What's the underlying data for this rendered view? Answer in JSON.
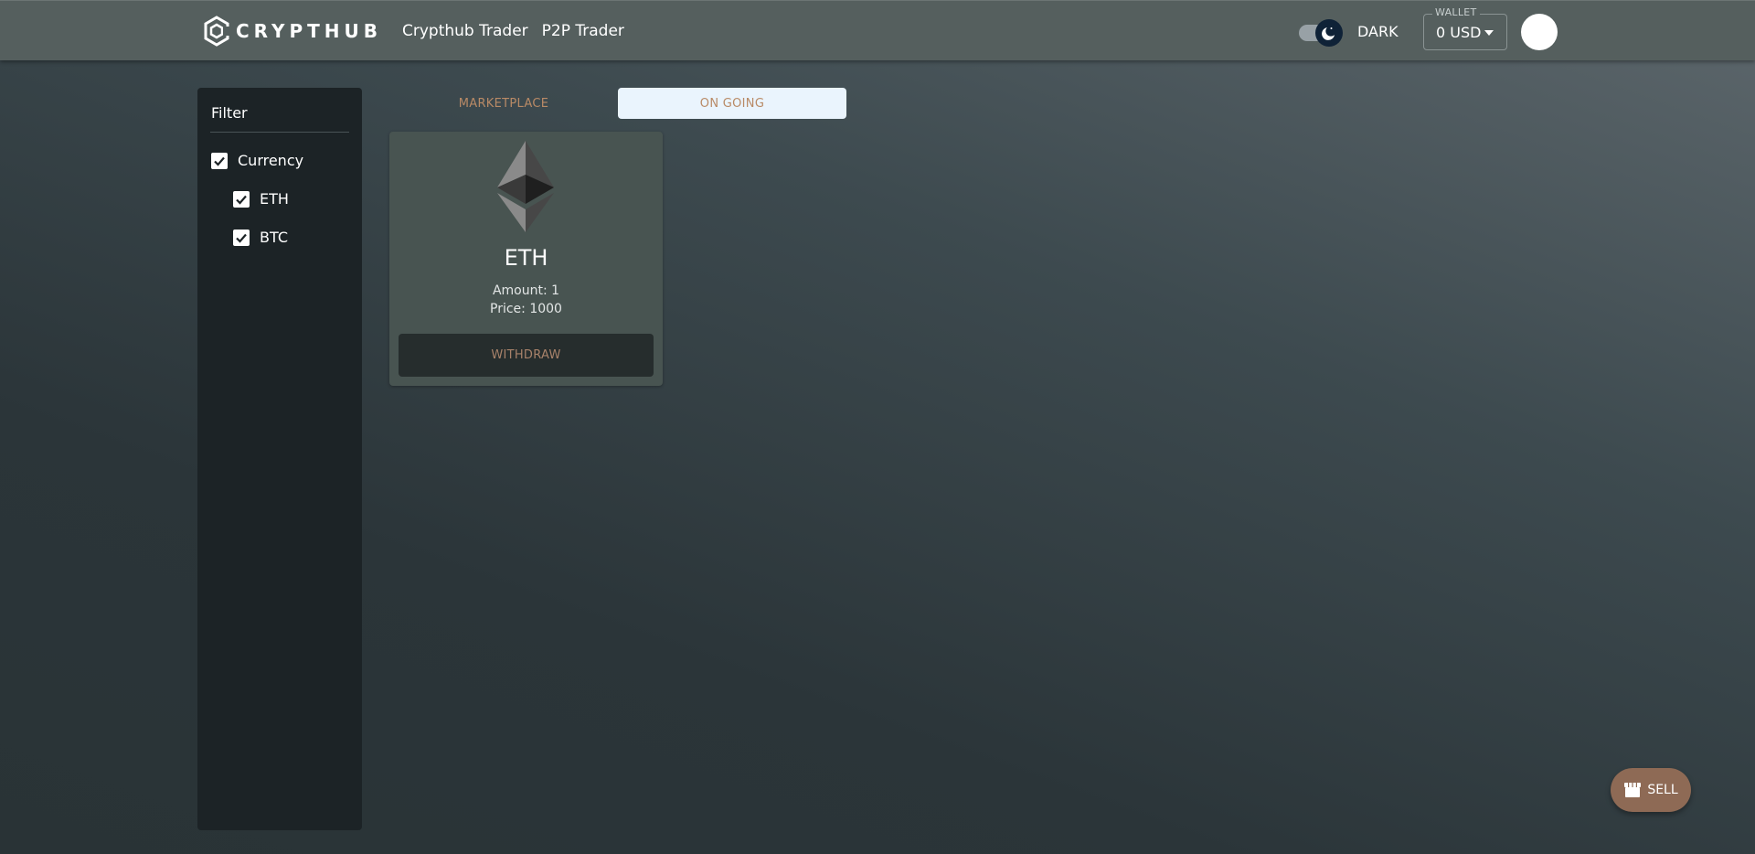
{
  "header": {
    "brand": "CRYPTHUB",
    "nav": [
      "Crypthub Trader",
      "P2P Trader"
    ],
    "theme_label": "DARK",
    "wallet": {
      "legend": "WALLET",
      "value": "0 USD"
    }
  },
  "sidebar": {
    "title": "Filter",
    "filters": [
      {
        "label": "Currency",
        "checked": true
      },
      {
        "label": "ETH",
        "checked": true
      },
      {
        "label": "BTC",
        "checked": true
      }
    ]
  },
  "tabs": [
    {
      "label": "MARKETPLACE",
      "active": false
    },
    {
      "label": "ON GOING",
      "active": true
    }
  ],
  "card": {
    "title": "ETH",
    "amount": "Amount: 1",
    "price": "Price: 1000",
    "action": "WITHDRAW",
    "icon": "ethereum-icon"
  },
  "fab": {
    "label": "SELL",
    "icon": "store-icon"
  },
  "colors": {
    "accent": "#b98a66",
    "fab": "#8e6a55",
    "active_tab": "#eaf4fd",
    "sidebar": "#1c2326",
    "card": "#485451"
  }
}
